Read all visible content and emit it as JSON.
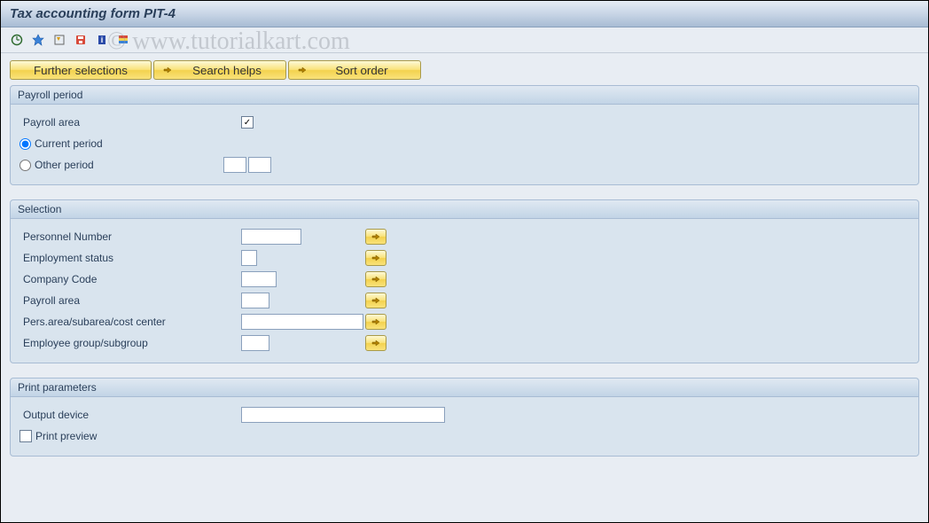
{
  "title": "Tax accounting form PIT-4",
  "watermark": "© www.tutorialkart.com",
  "buttons": {
    "further_selections": "Further selections",
    "search_helps": "Search helps",
    "sort_order": "Sort order"
  },
  "group_payroll": {
    "title": "Payroll period",
    "payroll_area_label": "Payroll area",
    "payroll_area_value": "",
    "current_period": "Current period",
    "other_period": "Other period",
    "other_period_v1": "",
    "other_period_v2": ""
  },
  "group_selection": {
    "title": "Selection",
    "rows": {
      "personnel_number": {
        "label": "Personnel Number",
        "value": ""
      },
      "employment_status": {
        "label": "Employment status",
        "value": ""
      },
      "company_code": {
        "label": "Company Code",
        "value": ""
      },
      "payroll_area": {
        "label": "Payroll area",
        "value": ""
      },
      "pers_area": {
        "label": "Pers.area/subarea/cost center",
        "value": ""
      },
      "employee_group": {
        "label": "Employee group/subgroup",
        "value": ""
      }
    }
  },
  "group_print": {
    "title": "Print parameters",
    "output_device_label": "Output device",
    "output_device_value": "",
    "print_preview_label": "Print preview"
  }
}
